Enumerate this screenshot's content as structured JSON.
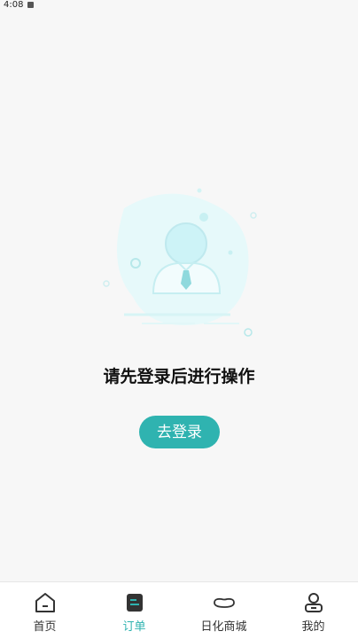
{
  "status_bar": {
    "time": "4:08"
  },
  "empty_state": {
    "message": "请先登录后进行操作",
    "login_button": "去登录"
  },
  "tabs": [
    {
      "label": "首页",
      "icon": "home-icon",
      "active": false
    },
    {
      "label": "订单",
      "icon": "order-icon",
      "active": true
    },
    {
      "label": "日化商城",
      "icon": "shop-icon",
      "active": false
    },
    {
      "label": "我的",
      "icon": "profile-icon",
      "active": false
    }
  ],
  "colors": {
    "accent": "#2fb3b0",
    "illustration": "#d9f6f7"
  }
}
